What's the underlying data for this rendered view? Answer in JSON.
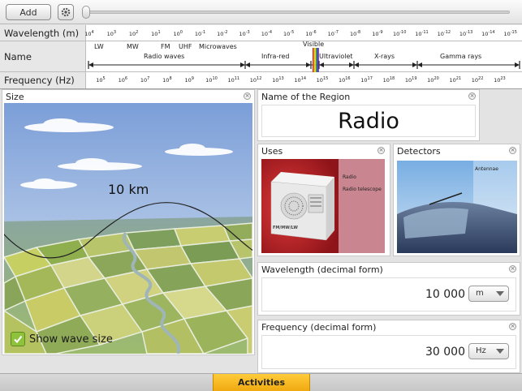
{
  "toolbar": {
    "add_label": "Add",
    "settings_icon": "gear-icon",
    "slider_level": 0
  },
  "spectrum": {
    "wavelength_label": "Wavelength (m)",
    "name_label": "Name",
    "frequency_label": "Frequency (Hz)",
    "wavelength_ticks": [
      {
        "base": "10",
        "exp": "4"
      },
      {
        "base": "10",
        "exp": "3"
      },
      {
        "base": "10",
        "exp": "2"
      },
      {
        "base": "10",
        "exp": "1"
      },
      {
        "base": "10",
        "exp": "0"
      },
      {
        "base": "10",
        "exp": "-1"
      },
      {
        "base": "10",
        "exp": "-2"
      },
      {
        "base": "10",
        "exp": "-3"
      },
      {
        "base": "10",
        "exp": "-4"
      },
      {
        "base": "10",
        "exp": "-5"
      },
      {
        "base": "10",
        "exp": "-6"
      },
      {
        "base": "10",
        "exp": "-7"
      },
      {
        "base": "10",
        "exp": "-8"
      },
      {
        "base": "10",
        "exp": "-9"
      },
      {
        "base": "10",
        "exp": "-10"
      },
      {
        "base": "10",
        "exp": "-11"
      },
      {
        "base": "10",
        "exp": "-12"
      },
      {
        "base": "10",
        "exp": "-13"
      },
      {
        "base": "10",
        "exp": "-14"
      },
      {
        "base": "10",
        "exp": "-15"
      }
    ],
    "frequency_ticks": [
      {
        "base": "10",
        "exp": "5"
      },
      {
        "base": "10",
        "exp": "6"
      },
      {
        "base": "10",
        "exp": "7"
      },
      {
        "base": "10",
        "exp": "8"
      },
      {
        "base": "10",
        "exp": "9"
      },
      {
        "base": "10",
        "exp": "10"
      },
      {
        "base": "10",
        "exp": "11"
      },
      {
        "base": "10",
        "exp": "12"
      },
      {
        "base": "10",
        "exp": "13"
      },
      {
        "base": "10",
        "exp": "14"
      },
      {
        "base": "10",
        "exp": "15"
      },
      {
        "base": "10",
        "exp": "16"
      },
      {
        "base": "10",
        "exp": "17"
      },
      {
        "base": "10",
        "exp": "18"
      },
      {
        "base": "10",
        "exp": "19"
      },
      {
        "base": "10",
        "exp": "20"
      },
      {
        "base": "10",
        "exp": "21"
      },
      {
        "base": "10",
        "exp": "22"
      },
      {
        "base": "10",
        "exp": "23"
      }
    ],
    "sub_bands": {
      "lw": "LW",
      "mw": "MW",
      "fm": "FM",
      "uhf": "UHF",
      "microwaves": "Microwaves",
      "visible": "Visible"
    },
    "regions": {
      "radio": "Radio waves",
      "infrared": "Infra-red",
      "ultraviolet": "Ultraviolet",
      "xrays": "X-rays",
      "gamma": "Gamma rays"
    }
  },
  "size_panel": {
    "title": "Size",
    "scale_text": "10 km",
    "show_wave_label": "Show wave size",
    "show_wave_checked": true
  },
  "region_panel": {
    "title": "Name of the Region",
    "value": "Radio"
  },
  "uses_panel": {
    "title": "Uses",
    "radio_brand": "FM/MW/LW",
    "labels": [
      "Radio",
      "Radio telescope"
    ]
  },
  "detectors_panel": {
    "title": "Detectors",
    "labels": [
      "Antennae"
    ]
  },
  "wavelength_panel": {
    "title": "Wavelength (decimal form)",
    "value": "10 000",
    "unit": "m"
  },
  "frequency_panel": {
    "title": "Frequency (decimal form)",
    "value": "30 000",
    "unit": "Hz"
  },
  "bottom": {
    "activities_label": "Activities"
  },
  "colors": {
    "accent": "#f3b41c",
    "checkbox": "#8fc23c",
    "sky_top": "#7b9ed8",
    "uses_bg": "#b8202a"
  }
}
